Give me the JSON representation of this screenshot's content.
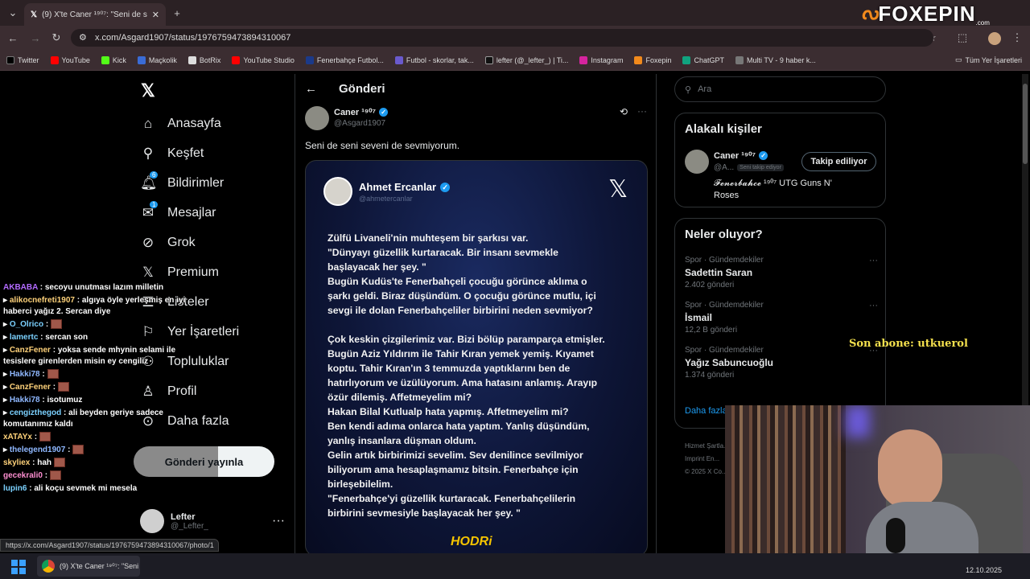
{
  "browser": {
    "tab_title": "(9) X'te Caner ¹⁹⁰⁷: \"Seni de sen",
    "url": "x.com/Asgard1907/status/1976759473894310067",
    "bookmarks": [
      "Twitter",
      "YouTube",
      "Kick",
      "Maçkolik",
      "BotRix",
      "YouTube Studio",
      "Fenerbahçe Futbol...",
      "Futbol - skorlar, tak...",
      "lefter (@_lefter_) | Ti...",
      "Instagram",
      "Foxepin",
      "ChatGPT",
      "Multi TV - 9 haber k..."
    ],
    "all_bookmarks": "Tüm Yer İşaretleri",
    "status_url": "https://x.com/Asgard1907/status/1976759473894310067/photo/1"
  },
  "watermark": {
    "brand": "FOXEPIN",
    "suffix": ".com"
  },
  "nav": {
    "items": [
      "Anasayfa",
      "Keşfet",
      "Bildirimler",
      "Mesajlar",
      "Grok",
      "Premium",
      "Listeler",
      "Yer İşaretleri",
      "Topluluklar",
      "Profil",
      "Daha fazla"
    ],
    "notif_badge": "6",
    "msg_badge": "1",
    "post_button": "Gönderi yayınla",
    "account_name": "Lefter",
    "account_handle": "@_Lefter_"
  },
  "post": {
    "header": "Gönderi",
    "author": "Caner ¹⁹⁰⁷",
    "handle": "@Asgard1907",
    "text": "Seni de seni seveni de sevmiyorum.",
    "image": {
      "author": "Ahmet Ercanlar",
      "handle": "@ahmetercanlar",
      "p1": [
        "Zülfü Livaneli'nin muhteşem bir şarkısı var.",
        "\"Dünyayı güzellik kurtaracak. Bir insanı sevmekle",
        "başlayacak her şey. \"",
        "Bugün Kudüs'te Fenerbahçeli çocuğu görünce aklıma o",
        "şarkı geldi. Biraz düşündüm. O çocuğu görünce mutlu, içi",
        "sevgi ile dolan Fenerbahçeliler birbirini neden sevmiyor?"
      ],
      "p2": [
        "Çok keskin çizgilerimiz var. Bizi bölüp paramparça etmişler.",
        "Bugün Aziz Yıldırım ile Tahir Kıran yemek yemiş. Kıyamet",
        "koptu. Tahir Kıran'ın 3 temmuzda yaptıklarını ben de",
        "hatırlıyorum ve üzülüyorum. Ama hatasını anlamış. Arayıp",
        "özür dilemiş. Affetmeyelim mi?",
        "Hakan Bilal Kutlualp hata yapmış. Affetmeyelim mi?",
        "Ben kendi adıma onlarca hata yaptım. Yanlış düşündüm,",
        "yanlış insanlara düşman oldum.",
        "Gelin artık birbirimizi sevelim. Sev denilince sevilmiyor",
        "biliyorum ama hesaplaşmamız bitsin. Fenerbahçe için",
        "birleşebilelim.",
        "\"Fenerbahçe'yi güzellik kurtaracak. Fenerbahçelilerin",
        "birbirini sevmesiyle başlayacak her şey. \""
      ],
      "footer": "HODRi"
    }
  },
  "right": {
    "search_placeholder": "Ara",
    "related_title": "Alakalı kişiler",
    "related_name": "Caner ¹⁹⁰⁷",
    "related_handle": "@A...",
    "follows_you": "Seni takip ediyor",
    "follow_button": "Takip ediliyor",
    "related_bio": "𝓕𝓮𝓷𝓮𝓻𝓫𝓪𝓱𝓬𝓮 ¹⁹⁰⁷ UTG Guns N' Roses",
    "trends_title": "Neler oluyor?",
    "trends": [
      {
        "category": "Spor · Gündemdekiler",
        "name": "Sadettin Saran",
        "count": "2.402 gönderi"
      },
      {
        "category": "Spor · Gündemdekiler",
        "name": "İsmail",
        "count": "12,2 B gönderi"
      },
      {
        "category": "Spor · Gündemdekiler",
        "name": "Yağız Sabuncuoğlu",
        "count": "1.374 gönderi"
      }
    ],
    "show_more": "Daha fazla",
    "footer": [
      "Hizmet Şartla...",
      "Imprint",
      "En...",
      "© 2025 X Co..."
    ]
  },
  "overlay": {
    "last_sub": "Son abone: utkuerol"
  },
  "chat": [
    {
      "user": "AKBABA",
      "color": "#b36bff",
      "msg": "secoyu unutması lazım milletin",
      "emote": false
    },
    {
      "user": "alikocnefreti1907",
      "color": "#ffd27a",
      "msg": "algıya öyle yerleşmiş en iyi haberci yağız 2. Sercan diye",
      "emote": false
    },
    {
      "user": "O_Olrico",
      "color": "#7bd1ff",
      "msg": "",
      "emote": true
    },
    {
      "user": "lamertc",
      "color": "#7bd1ff",
      "msg": "sercan son",
      "emote": false
    },
    {
      "user": "CanzFener",
      "color": "#ffd27a",
      "msg": "yoksa sende mhynin selami ile tesislere girenlerden misin ey cengiliz",
      "emote": false
    },
    {
      "user": "Hakki78",
      "color": "#8fb8ff",
      "msg": "",
      "emote": true
    },
    {
      "user": "CanzFener",
      "color": "#ffd27a",
      "msg": "",
      "emote": true
    },
    {
      "user": "Hakki78",
      "color": "#8fb8ff",
      "msg": "isotumuz",
      "emote": false
    },
    {
      "user": "cengizthegod",
      "color": "#7bd1ff",
      "msg": "ali beyden geriye sadece komutanımız kaldı",
      "emote": false
    },
    {
      "user": "xATAYx",
      "color": "#ffd27a",
      "msg": "",
      "emote": true
    },
    {
      "user": "thelegend1907",
      "color": "#8fb8ff",
      "msg": "",
      "emote": true
    },
    {
      "user": "skyliex",
      "color": "#ffd27a",
      "msg": "hah",
      "emote": true
    },
    {
      "user": "gecekrali0",
      "color": "#ff8fd1",
      "msg": "",
      "emote": true
    },
    {
      "user": "lupin6",
      "color": "#7bd1ff",
      "msg": "ali koçu sevmek mi mesela",
      "emote": false
    }
  ],
  "taskbar": {
    "app_label": "(9) X'te Caner ¹⁹⁰⁷: \"Seni",
    "date": "12.10.2025"
  }
}
